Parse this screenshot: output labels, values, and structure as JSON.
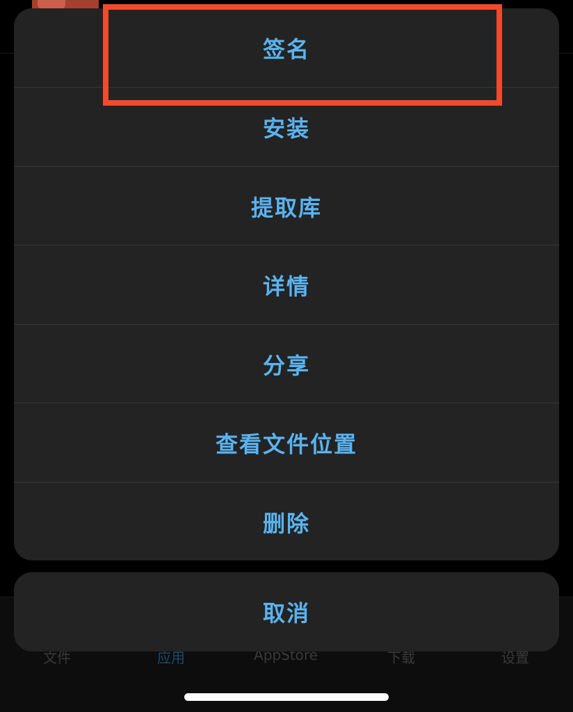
{
  "colors": {
    "accent": "#5ab3f0",
    "sheet_bg": "#232323",
    "highlight": "#f24a2c"
  },
  "background_tabbar": {
    "tabs": [
      {
        "label": "文件"
      },
      {
        "label": "应用",
        "active": true
      },
      {
        "label": "AppStore"
      },
      {
        "label": "下载"
      },
      {
        "label": "设置"
      }
    ]
  },
  "action_sheet": {
    "items": [
      {
        "label": "签名"
      },
      {
        "label": "安装"
      },
      {
        "label": "提取库"
      },
      {
        "label": "详情"
      },
      {
        "label": "分享"
      },
      {
        "label": "查看文件位置"
      },
      {
        "label": "删除"
      }
    ],
    "cancel_label": "取消"
  }
}
